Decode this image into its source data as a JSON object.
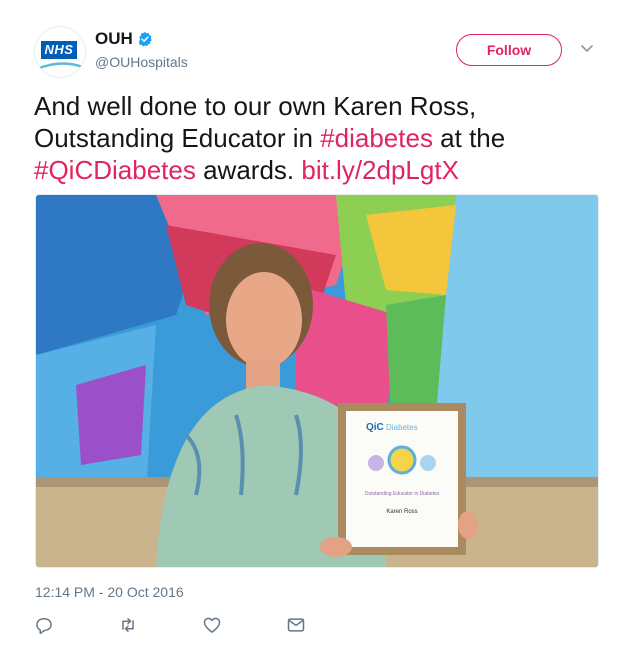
{
  "header": {
    "avatar_label": "NHS",
    "display_name": "OUH",
    "handle": "@OUHospitals",
    "follow_label": "Follow"
  },
  "tweet": {
    "text_1": "And well done to our own Karen Ross, Outstanding Educator in ",
    "hashtag_1": "#diabetes",
    "text_2": " at the ",
    "hashtag_2": "#QiCDiabetes",
    "text_3": " awards. ",
    "link": "bit.ly/2dpLgtX"
  },
  "media": {
    "certificate_brand": "QiC",
    "certificate_brand_sub": "Diabetes",
    "certificate_award": "Outstanding Educator in Diabetes",
    "certificate_name": "Karen Ross"
  },
  "footer": {
    "timestamp": "12:14 PM - 20 Oct 2016"
  },
  "icons": {
    "reply": "reply-icon",
    "retweet": "retweet-icon",
    "like": "like-icon",
    "message": "message-icon",
    "verified": "verified-badge-icon"
  },
  "colors": {
    "accent": "#e0245e",
    "verified": "#1da1f2",
    "nhs_blue": "#005eb8",
    "muted": "#657786"
  }
}
